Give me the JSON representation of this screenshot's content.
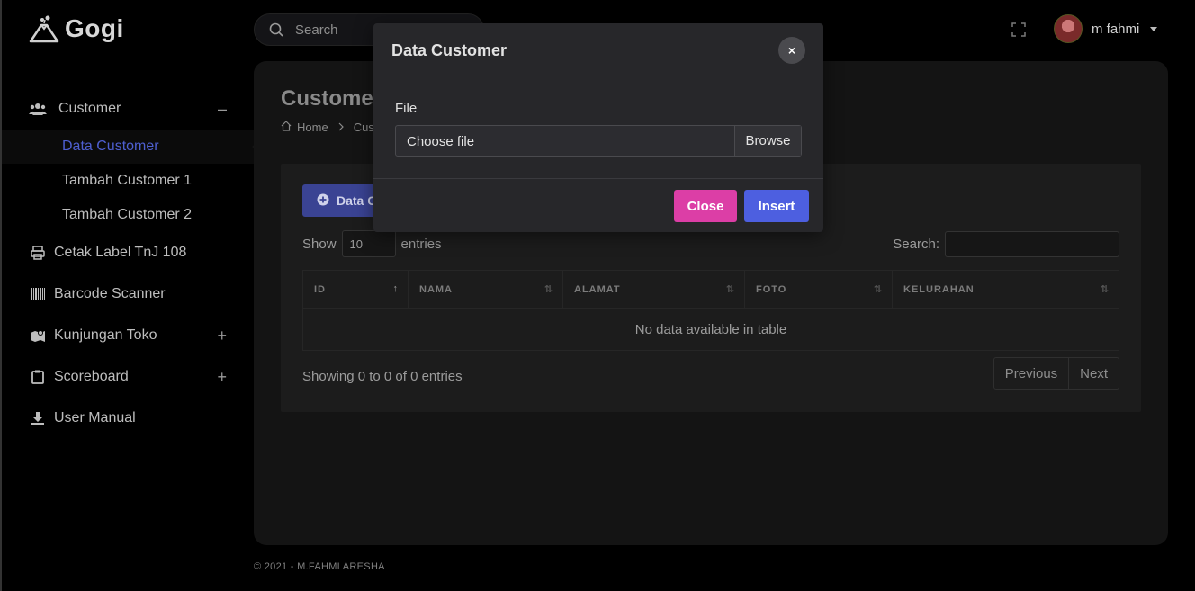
{
  "brand": {
    "name": "Gogi"
  },
  "topbar": {
    "search_placeholder": "Search",
    "user_name": "m fahmi"
  },
  "sidebar": {
    "items": [
      {
        "label": "Customer",
        "icon": "users-icon",
        "toggle": "–"
      },
      {
        "label": "Cetak Label TnJ 108",
        "icon": "printer-icon"
      },
      {
        "label": "Barcode Scanner",
        "icon": "barcode-icon"
      },
      {
        "label": "Kunjungan Toko",
        "icon": "map-icon",
        "toggle": "+"
      },
      {
        "label": "Scoreboard",
        "icon": "clipboard-icon",
        "toggle": "+"
      },
      {
        "label": "User Manual",
        "icon": "download-icon"
      }
    ],
    "sub_items": [
      {
        "label": "Data Customer",
        "active": true
      },
      {
        "label": "Tambah Customer 1"
      },
      {
        "label": "Tambah Customer 2"
      }
    ]
  },
  "page": {
    "title": "Customer",
    "breadcrumb": [
      "Home",
      "Cus"
    ],
    "add_button": "Data C",
    "show_label": "Show",
    "entries_value": "10",
    "entries_label": "entries",
    "search_label": "Search:",
    "columns": [
      "ID",
      "NAMA",
      "ALAMAT",
      "FOTO",
      "KELURAHAN"
    ],
    "empty_message": "No data available in table",
    "info": "Showing 0 to 0 of 0 entries",
    "pager": {
      "previous": "Previous",
      "next": "Next"
    }
  },
  "footer": {
    "text": "© 2021 - M.FAHMI ARESHA"
  },
  "modal": {
    "title": "Data Customer",
    "close_x": "×",
    "file_label": "File",
    "file_placeholder": "Choose file",
    "browse_label": "Browse",
    "close_button": "Close",
    "insert_button": "Insert"
  },
  "colors": {
    "accent": "#4d5fe0",
    "close_button": "#dc3ea6",
    "active_link": "#4e5fd0"
  }
}
